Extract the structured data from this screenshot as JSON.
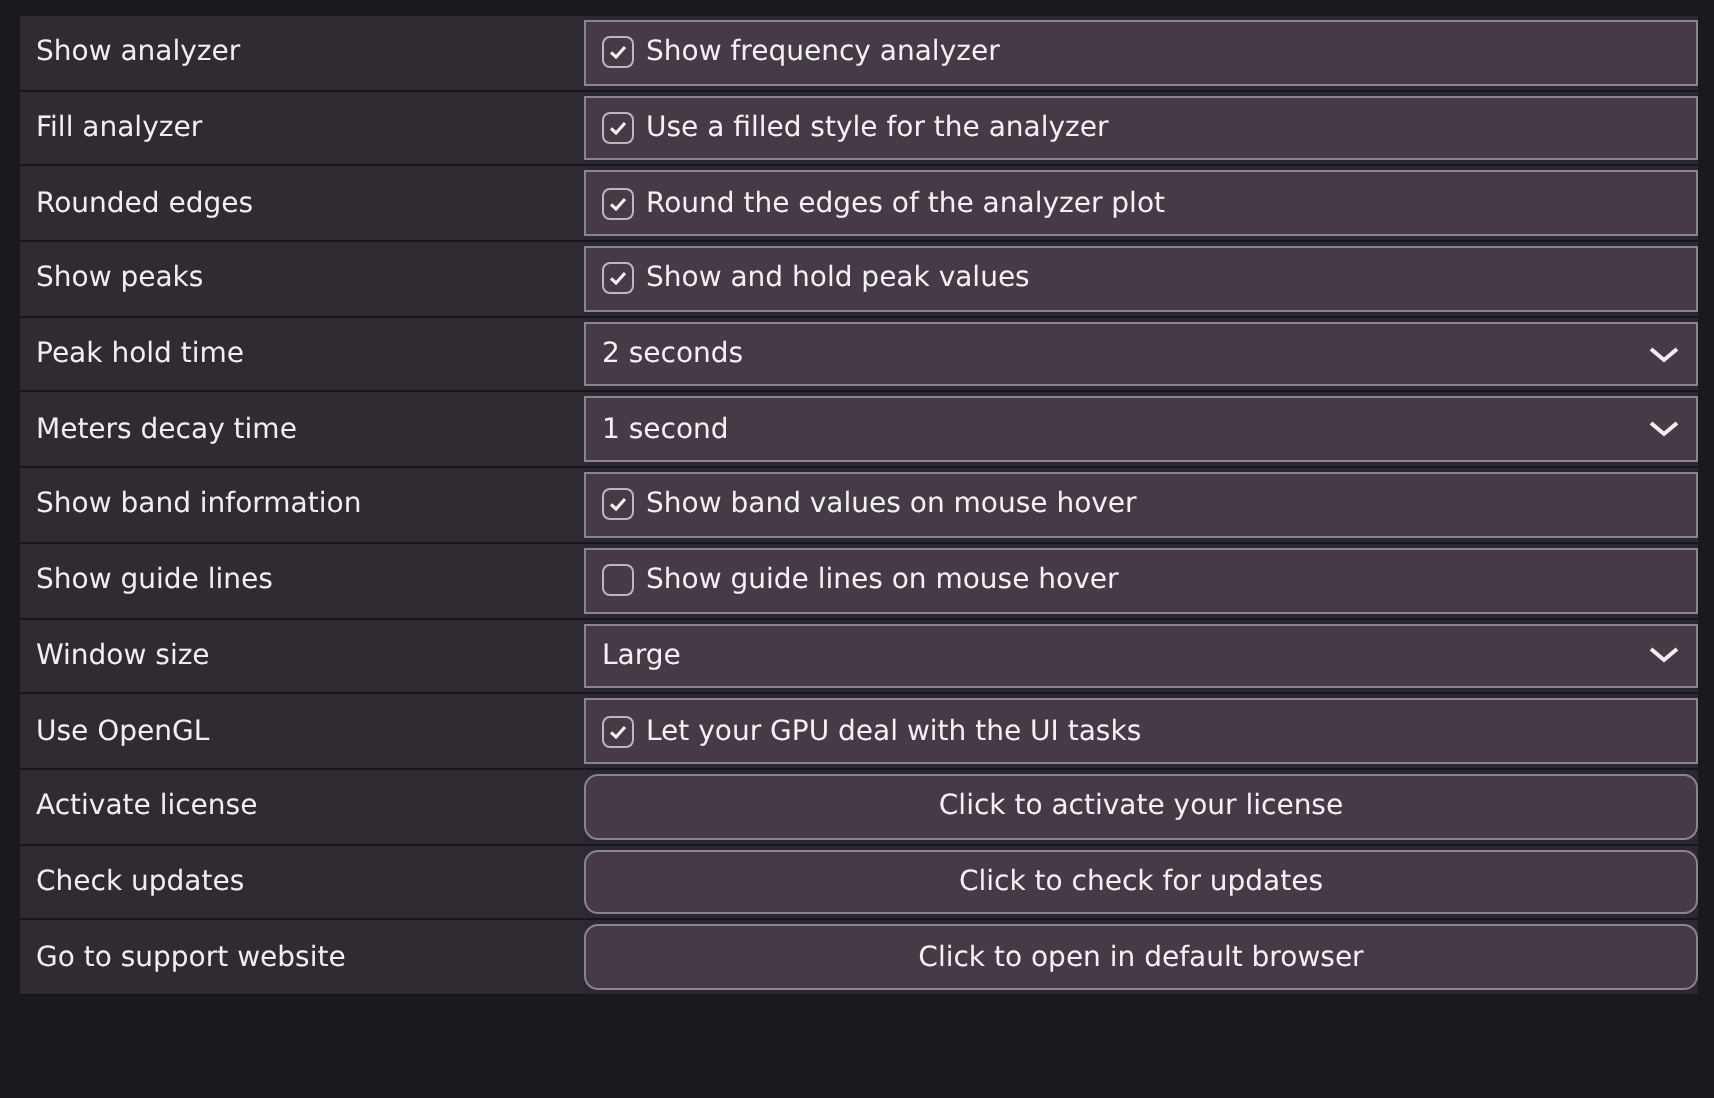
{
  "settings": [
    {
      "label": "Show analyzer",
      "kind": "checkbox",
      "text": "Show frequency analyzer",
      "checked": true
    },
    {
      "label": "Fill analyzer",
      "kind": "checkbox",
      "text": "Use a filled style for the analyzer",
      "checked": true
    },
    {
      "label": "Rounded edges",
      "kind": "checkbox",
      "text": "Round the edges of the analyzer plot",
      "checked": true
    },
    {
      "label": "Show peaks",
      "kind": "checkbox",
      "text": "Show and hold peak values",
      "checked": true
    },
    {
      "label": "Peak hold time",
      "kind": "dropdown",
      "text": "2 seconds"
    },
    {
      "label": "Meters decay time",
      "kind": "dropdown",
      "text": "1 second"
    },
    {
      "label": "Show band information",
      "kind": "checkbox",
      "text": "Show band values on mouse hover",
      "checked": true
    },
    {
      "label": "Show guide lines",
      "kind": "checkbox",
      "text": "Show guide lines on mouse hover",
      "checked": false
    },
    {
      "label": "Window size",
      "kind": "dropdown",
      "text": "Large"
    },
    {
      "label": "Use OpenGL",
      "kind": "checkbox",
      "text": "Let your GPU deal with the UI tasks",
      "checked": true
    },
    {
      "label": "Activate license",
      "kind": "button",
      "text": "Click to activate your license"
    },
    {
      "label": "Check updates",
      "kind": "button",
      "text": "Click to check for updates"
    },
    {
      "label": "Go to support website",
      "kind": "button",
      "text": "Click to open in default browser"
    }
  ]
}
